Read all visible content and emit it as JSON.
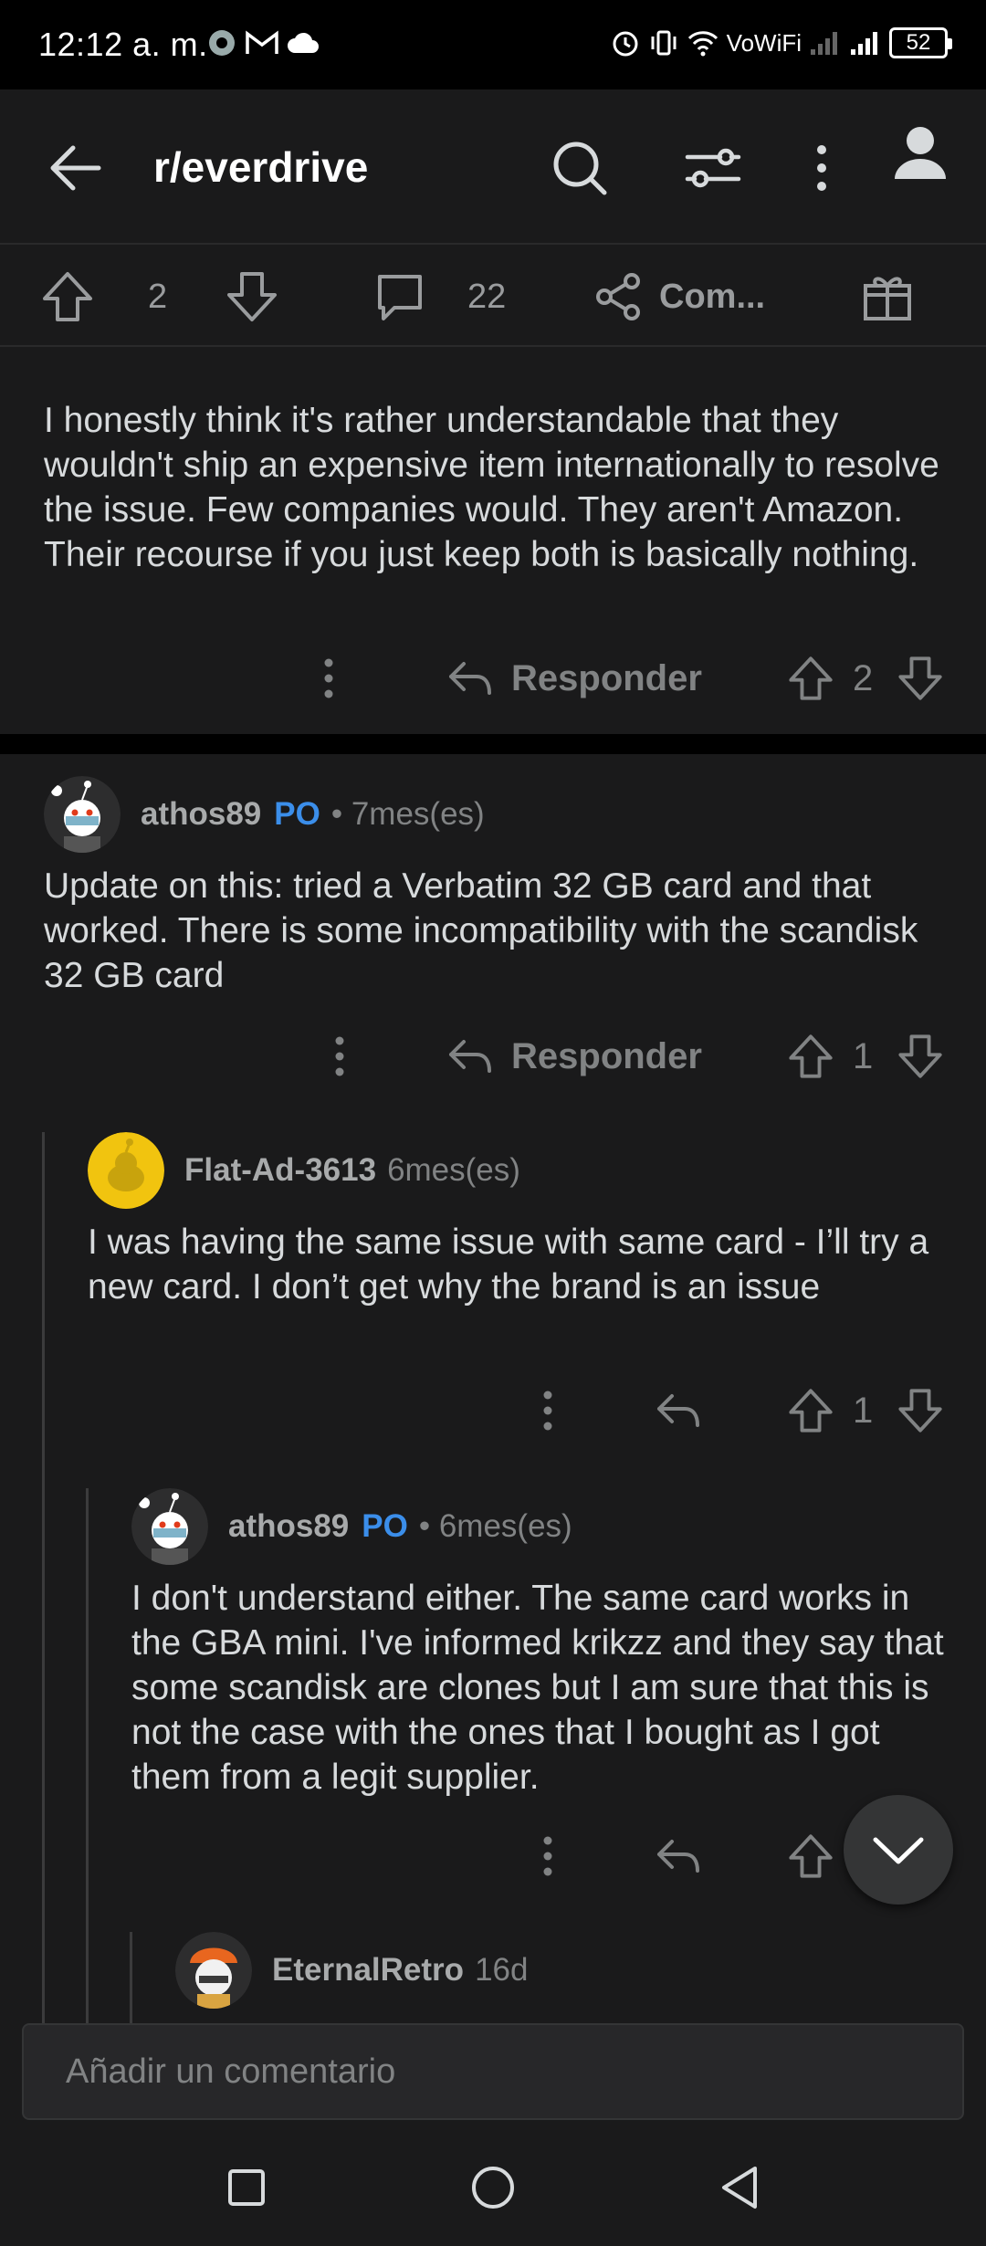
{
  "status_bar": {
    "time": "12:12 a. m.",
    "network_label": "VoWiFi",
    "battery": "52"
  },
  "app_bar": {
    "title": "r/everdrive",
    "icons": [
      "back-arrow-icon",
      "search-icon",
      "filter-icon",
      "more-vert-icon",
      "profile-icon"
    ]
  },
  "post_actions": {
    "upvotes": "2",
    "comments": "22",
    "share_label": "Com...",
    "icons": [
      "upvote-icon",
      "downvote-icon",
      "comment-icon",
      "share-icon",
      "award-icon"
    ]
  },
  "comments": [
    {
      "text": "I honestly think it's rather understandable that they wouldn't ship an expensive item internationally to resolve the issue. Few companies would. They aren't Amazon. Their recourse if you just keep both is basically nothing.",
      "reply_label": "Responder",
      "votes": "2"
    },
    {
      "username": "athos89",
      "op_tag": "PO",
      "meta": "• 7mes(es)",
      "text": "Update on this: tried a Verbatim 32 GB card and that worked. There is some incompatibility with the scandisk 32 GB card",
      "reply_label": "Responder",
      "votes": "1"
    },
    {
      "username": "Flat-Ad-3613",
      "meta": "6mes(es)",
      "text": "I was having the same issue with same card - I’ll try a new card. I don’t get why the brand is an issue",
      "votes": "1"
    },
    {
      "username": "athos89",
      "op_tag": "PO",
      "meta": "• 6mes(es)",
      "text": "I don't understand either. The same card works in the GBA mini. I've informed krikzz and they say that some scandisk are clones but I am sure that this is not the case with the ones that I bought as I got them from a legit supplier."
    },
    {
      "username": "EternalRetro",
      "meta": "16d"
    }
  ],
  "comment_input": {
    "placeholder": "Añadir un comentario"
  },
  "nav_bar": {
    "icons": [
      "recents-icon",
      "home-icon",
      "back-icon"
    ]
  },
  "colors": {
    "background": "#1a1a1b",
    "op_accent": "#3b8eea",
    "text": "#d7dadc",
    "muted": "#818384"
  }
}
